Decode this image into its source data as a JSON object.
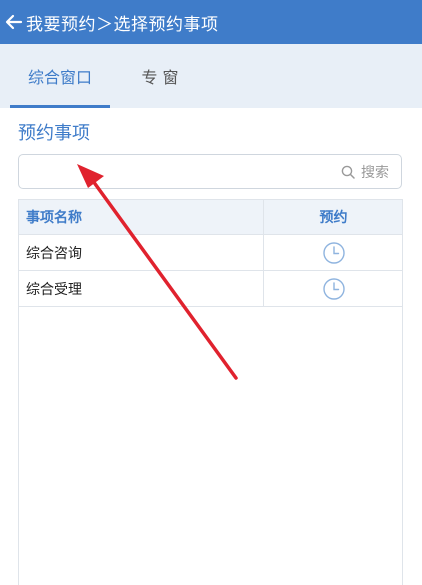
{
  "header": {
    "title": "我要预约＞选择预约事项"
  },
  "tabs": [
    {
      "label": "综合窗口",
      "active": true
    },
    {
      "label": "专 窗",
      "active": false
    }
  ],
  "section": {
    "title": "预约事项"
  },
  "search": {
    "value": "",
    "button_label": "搜索"
  },
  "table": {
    "headers": [
      "事项名称",
      "预约"
    ],
    "rows": [
      {
        "name": "综合咨询"
      },
      {
        "name": "综合受理"
      }
    ]
  },
  "colors": {
    "primary": "#3f7cc9",
    "annotation": "#e0222e"
  },
  "icons": {
    "back": "arrow-left-icon",
    "search": "search-icon",
    "booking": "clock-icon"
  }
}
